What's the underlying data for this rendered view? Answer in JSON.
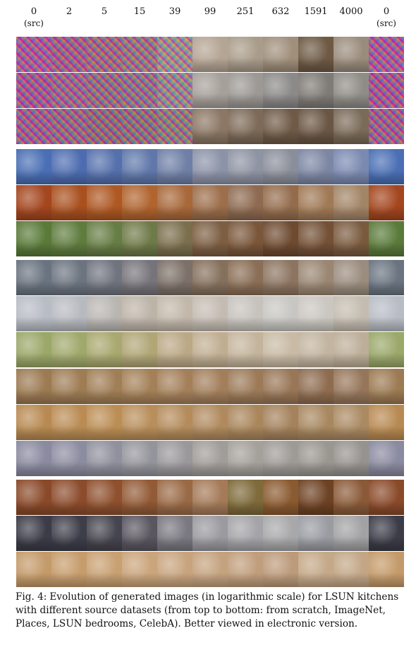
{
  "figure": {
    "column_headers": [
      {
        "value": "0",
        "sub": "(src)"
      },
      {
        "value": "2",
        "sub": ""
      },
      {
        "value": "5",
        "sub": ""
      },
      {
        "value": "15",
        "sub": ""
      },
      {
        "value": "39",
        "sub": ""
      },
      {
        "value": "99",
        "sub": ""
      },
      {
        "value": "251",
        "sub": ""
      },
      {
        "value": "632",
        "sub": ""
      },
      {
        "value": "1591",
        "sub": ""
      },
      {
        "value": "4000",
        "sub": ""
      },
      {
        "value": "0",
        "sub": "(src)"
      }
    ],
    "groups": [
      {
        "rows": [
          {
            "tiles": [
              {
                "kind": "noise",
                "color": "#b04a9c"
              },
              {
                "kind": "noise",
                "color": "#a94f86"
              },
              {
                "kind": "noise",
                "color": "#a5607a"
              },
              {
                "kind": "noise",
                "color": "#9c6f7c"
              },
              {
                "kind": "noise",
                "color": "#a99990"
              },
              {
                "kind": "image",
                "color": "#b5a594"
              },
              {
                "kind": "image",
                "color": "#a99c8a"
              },
              {
                "kind": "image",
                "color": "#a08f7b"
              },
              {
                "kind": "image",
                "color": "#6e5a44"
              },
              {
                "kind": "image",
                "color": "#9a8c7c"
              },
              {
                "kind": "noise",
                "color": "#b04a9c"
              }
            ]
          },
          {
            "tiles": [
              {
                "kind": "noise",
                "color": "#a94692"
              },
              {
                "kind": "noise",
                "color": "#a05a8c"
              },
              {
                "kind": "noise",
                "color": "#95647a"
              },
              {
                "kind": "noise",
                "color": "#8f6c83"
              },
              {
                "kind": "noise",
                "color": "#9b8f8d"
              },
              {
                "kind": "image",
                "color": "#a7a09a"
              },
              {
                "kind": "image",
                "color": "#9c9894"
              },
              {
                "kind": "image",
                "color": "#8c8a88"
              },
              {
                "kind": "image",
                "color": "#7f7b76"
              },
              {
                "kind": "image",
                "color": "#8f8c86"
              },
              {
                "kind": "noise",
                "color": "#a94692"
              }
            ]
          },
          {
            "tiles": [
              {
                "kind": "noise",
                "color": "#a0508a"
              },
              {
                "kind": "noise",
                "color": "#9a5a7e"
              },
              {
                "kind": "noise",
                "color": "#8c5e6e"
              },
              {
                "kind": "noise",
                "color": "#8a6670"
              },
              {
                "kind": "noise",
                "color": "#8e7a70"
              },
              {
                "kind": "image",
                "color": "#8b7764"
              },
              {
                "kind": "image",
                "color": "#7d6a58"
              },
              {
                "kind": "image",
                "color": "#6f5a47"
              },
              {
                "kind": "image",
                "color": "#6a5644"
              },
              {
                "kind": "image",
                "color": "#7a6a58"
              },
              {
                "kind": "noise",
                "color": "#a0508a"
              }
            ]
          }
        ]
      },
      {
        "rows": [
          {
            "tiles": [
              {
                "kind": "image",
                "color": "#4a6fb4"
              },
              {
                "kind": "image",
                "color": "#4d6cb0"
              },
              {
                "kind": "image",
                "color": "#5570ac"
              },
              {
                "kind": "image",
                "color": "#5f77aa"
              },
              {
                "kind": "image",
                "color": "#6f7fa6"
              },
              {
                "kind": "image",
                "color": "#8c93a8"
              },
              {
                "kind": "image",
                "color": "#8f94a3"
              },
              {
                "kind": "image",
                "color": "#8a8e9a"
              },
              {
                "kind": "image",
                "color": "#7d87a4"
              },
              {
                "kind": "image",
                "color": "#7a89b0"
              },
              {
                "kind": "image",
                "color": "#4a6fb4"
              }
            ]
          },
          {
            "tiles": [
              {
                "kind": "image",
                "color": "#a4461e"
              },
              {
                "kind": "image",
                "color": "#a9501f"
              },
              {
                "kind": "image",
                "color": "#ae5823"
              },
              {
                "kind": "image",
                "color": "#b0642e"
              },
              {
                "kind": "image",
                "color": "#a8683a"
              },
              {
                "kind": "image",
                "color": "#9c6e4a"
              },
              {
                "kind": "image",
                "color": "#8e6a50"
              },
              {
                "kind": "image",
                "color": "#946c4c"
              },
              {
                "kind": "image",
                "color": "#a07a56"
              },
              {
                "kind": "image",
                "color": "#a28466"
              },
              {
                "kind": "image",
                "color": "#a4461e"
              }
            ]
          },
          {
            "tiles": [
              {
                "kind": "image",
                "color": "#5a7a3a"
              },
              {
                "kind": "image",
                "color": "#5f7c3e"
              },
              {
                "kind": "image",
                "color": "#667d44"
              },
              {
                "kind": "image",
                "color": "#6e7a48"
              },
              {
                "kind": "image",
                "color": "#7a6e4c"
              },
              {
                "kind": "image",
                "color": "#7c5e42"
              },
              {
                "kind": "image",
                "color": "#7a563a"
              },
              {
                "kind": "image",
                "color": "#6e4a30"
              },
              {
                "kind": "image",
                "color": "#735036"
              },
              {
                "kind": "image",
                "color": "#7a5a3e"
              },
              {
                "kind": "image",
                "color": "#5a7a3a"
              }
            ]
          }
        ]
      },
      {
        "rows": [
          {
            "tiles": [
              {
                "kind": "image",
                "color": "#6a7480"
              },
              {
                "kind": "image",
                "color": "#6c7480"
              },
              {
                "kind": "image",
                "color": "#70747e"
              },
              {
                "kind": "image",
                "color": "#76747a"
              },
              {
                "kind": "image",
                "color": "#7c7068"
              },
              {
                "kind": "image",
                "color": "#85705c"
              },
              {
                "kind": "image",
                "color": "#8a6e56"
              },
              {
                "kind": "image",
                "color": "#8c7460"
              },
              {
                "kind": "image",
                "color": "#9a8672"
              },
              {
                "kind": "image",
                "color": "#9a8c7e"
              },
              {
                "kind": "image",
                "color": "#6a7480"
              }
            ]
          },
          {
            "tiles": [
              {
                "kind": "image",
                "color": "#b8bcc4"
              },
              {
                "kind": "image",
                "color": "#b7bac0"
              },
              {
                "kind": "image",
                "color": "#b9b6b2"
              },
              {
                "kind": "image",
                "color": "#bdb4a8"
              },
              {
                "kind": "image",
                "color": "#c2b8aa"
              },
              {
                "kind": "image",
                "color": "#c4bcb2"
              },
              {
                "kind": "image",
                "color": "#c6c2bc"
              },
              {
                "kind": "image",
                "color": "#c8c6c2"
              },
              {
                "kind": "image",
                "color": "#cac6c0"
              },
              {
                "kind": "image",
                "color": "#c4bcb0"
              },
              {
                "kind": "image",
                "color": "#b8bcc4"
              }
            ]
          },
          {
            "tiles": [
              {
                "kind": "image",
                "color": "#9aa86a"
              },
              {
                "kind": "image",
                "color": "#a0a86c"
              },
              {
                "kind": "image",
                "color": "#a8a870"
              },
              {
                "kind": "image",
                "color": "#b0a676"
              },
              {
                "kind": "image",
                "color": "#bba886"
              },
              {
                "kind": "image",
                "color": "#c0ae92"
              },
              {
                "kind": "image",
                "color": "#c4b49c"
              },
              {
                "kind": "image",
                "color": "#c8baa4"
              },
              {
                "kind": "image",
                "color": "#c2b4a0"
              },
              {
                "kind": "image",
                "color": "#bcae98"
              },
              {
                "kind": "image",
                "color": "#9aa86a"
              }
            ]
          }
        ]
      },
      {
        "rows": [
          {
            "tiles": [
              {
                "kind": "image",
                "color": "#9c7a52"
              },
              {
                "kind": "image",
                "color": "#9e7c54"
              },
              {
                "kind": "image",
                "color": "#a07e56"
              },
              {
                "kind": "image",
                "color": "#a48058"
              },
              {
                "kind": "image",
                "color": "#a4805a"
              },
              {
                "kind": "image",
                "color": "#a27e5a"
              },
              {
                "kind": "image",
                "color": "#9c7a58"
              },
              {
                "kind": "image",
                "color": "#987656"
              },
              {
                "kind": "image",
                "color": "#8e6c50"
              },
              {
                "kind": "image",
                "color": "#96765a"
              },
              {
                "kind": "image",
                "color": "#9c7a52"
              }
            ]
          },
          {
            "tiles": [
              {
                "kind": "image",
                "color": "#b88a52"
              },
              {
                "kind": "image",
                "color": "#ba8c54"
              },
              {
                "kind": "image",
                "color": "#bc8e56"
              },
              {
                "kind": "image",
                "color": "#b88e5a"
              },
              {
                "kind": "image",
                "color": "#b48c5c"
              },
              {
                "kind": "image",
                "color": "#b08a5e"
              },
              {
                "kind": "image",
                "color": "#aa865c"
              },
              {
                "kind": "image",
                "color": "#a4825c"
              },
              {
                "kind": "image",
                "color": "#a88860"
              },
              {
                "kind": "image",
                "color": "#aa8a62"
              },
              {
                "kind": "image",
                "color": "#b88a52"
              }
            ]
          },
          {
            "tiles": [
              {
                "kind": "image",
                "color": "#8a8aa0"
              },
              {
                "kind": "image",
                "color": "#8c8ca0"
              },
              {
                "kind": "image",
                "color": "#90909e"
              },
              {
                "kind": "image",
                "color": "#94949c"
              },
              {
                "kind": "image",
                "color": "#9a989a"
              },
              {
                "kind": "image",
                "color": "#a09c98"
              },
              {
                "kind": "image",
                "color": "#a4a09a"
              },
              {
                "kind": "image",
                "color": "#9e9a96"
              },
              {
                "kind": "image",
                "color": "#9a9690"
              },
              {
                "kind": "image",
                "color": "#96928e"
              },
              {
                "kind": "image",
                "color": "#8a8aa0"
              }
            ]
          }
        ]
      },
      {
        "rows": [
          {
            "tiles": [
              {
                "kind": "image",
                "color": "#8a4a2a"
              },
              {
                "kind": "image",
                "color": "#8c4c2c"
              },
              {
                "kind": "image",
                "color": "#8e502e"
              },
              {
                "kind": "image",
                "color": "#925a36"
              },
              {
                "kind": "image",
                "color": "#9a6a46"
              },
              {
                "kind": "image",
                "color": "#a47a58"
              },
              {
                "kind": "image",
                "color": "#7e6a3a"
              },
              {
                "kind": "image",
                "color": "#8a5a30"
              },
              {
                "kind": "image",
                "color": "#6e4224"
              },
              {
                "kind": "image",
                "color": "#8a5a38"
              },
              {
                "kind": "image",
                "color": "#8a4a2a"
              }
            ]
          },
          {
            "tiles": [
              {
                "kind": "image",
                "color": "#3c3c48"
              },
              {
                "kind": "image",
                "color": "#3e3e4a"
              },
              {
                "kind": "image",
                "color": "#46444e"
              },
              {
                "kind": "image",
                "color": "#5a5660"
              },
              {
                "kind": "image",
                "color": "#7a7880"
              },
              {
                "kind": "image",
                "color": "#9a9aa0"
              },
              {
                "kind": "image",
                "color": "#a4a4a8"
              },
              {
                "kind": "image",
                "color": "#a8a8aa"
              },
              {
                "kind": "image",
                "color": "#9a9ca2"
              },
              {
                "kind": "image",
                "color": "#a2a2a4"
              },
              {
                "kind": "image",
                "color": "#3c3c48"
              }
            ]
          },
          {
            "tiles": [
              {
                "kind": "image",
                "color": "#c49a6a"
              },
              {
                "kind": "image",
                "color": "#c69c6c"
              },
              {
                "kind": "image",
                "color": "#c8a072"
              },
              {
                "kind": "image",
                "color": "#caa47a"
              },
              {
                "kind": "image",
                "color": "#c8a47e"
              },
              {
                "kind": "image",
                "color": "#c4a27e"
              },
              {
                "kind": "image",
                "color": "#c09e7c"
              },
              {
                "kind": "image",
                "color": "#bc9a7a"
              },
              {
                "kind": "image",
                "color": "#c4a888"
              },
              {
                "kind": "image",
                "color": "#c2a686"
              },
              {
                "kind": "image",
                "color": "#c49a6a"
              }
            ]
          }
        ]
      }
    ]
  },
  "caption": {
    "label": "Fig. 4:",
    "text": "Evolution of generated images (in logarithmic scale) for LSUN kitchens with different source datasets (from top to bottom: from scratch, ImageNet, Places, LSUN bedrooms, CelebA). Better viewed in electronic version."
  }
}
